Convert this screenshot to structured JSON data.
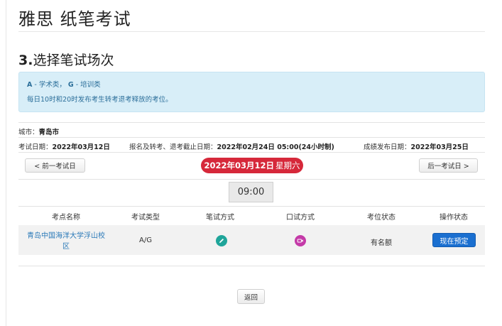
{
  "page": {
    "title": "雅思 纸笔考试",
    "section_number": "3.",
    "section_title": "选择笔试场次"
  },
  "info": {
    "a_code": "A",
    "a_text": " - 学术类，",
    "g_code": "G",
    "g_text": " - 培训类",
    "notice": "每日10时和20时发布考生转考退考释放的考位。"
  },
  "meta": {
    "city_label": "城市：",
    "city_value": "青岛市",
    "exam_date_label": "考试日期：",
    "exam_date_value": "2022年03月12日",
    "deadline_label": "报名及转考、退考截止日期：",
    "deadline_value": "2022年02月24日 05:00(24小时制)",
    "result_label": "成绩发布日期：",
    "result_value": "2022年03月25日"
  },
  "nav": {
    "prev_label": "< 前一考试日",
    "next_label": "后一考试日 >",
    "current_date": "2022年03月12日",
    "current_weekday": "星期六",
    "time": "09:00"
  },
  "table": {
    "headers": [
      "考点名称",
      "考试类型",
      "笔试方式",
      "口试方式",
      "考位状态",
      "操作状态"
    ],
    "rows": [
      {
        "venue_line1": "青岛中国海洋大学浮山校",
        "venue_line2": "区",
        "type": "A/G",
        "written_icon": "pencil-icon",
        "oral_icon": "video-camera-icon",
        "status": "有名额",
        "action": "现在预定"
      }
    ]
  },
  "footer": {
    "back_label": "返回"
  },
  "colors": {
    "info_bg": "#d8eef8",
    "date_pill": "#d6283a",
    "written_icon": "#1fa59a",
    "oral_icon": "#c43aa8",
    "book_button": "#1a6fd0",
    "link": "#2a79b8"
  }
}
